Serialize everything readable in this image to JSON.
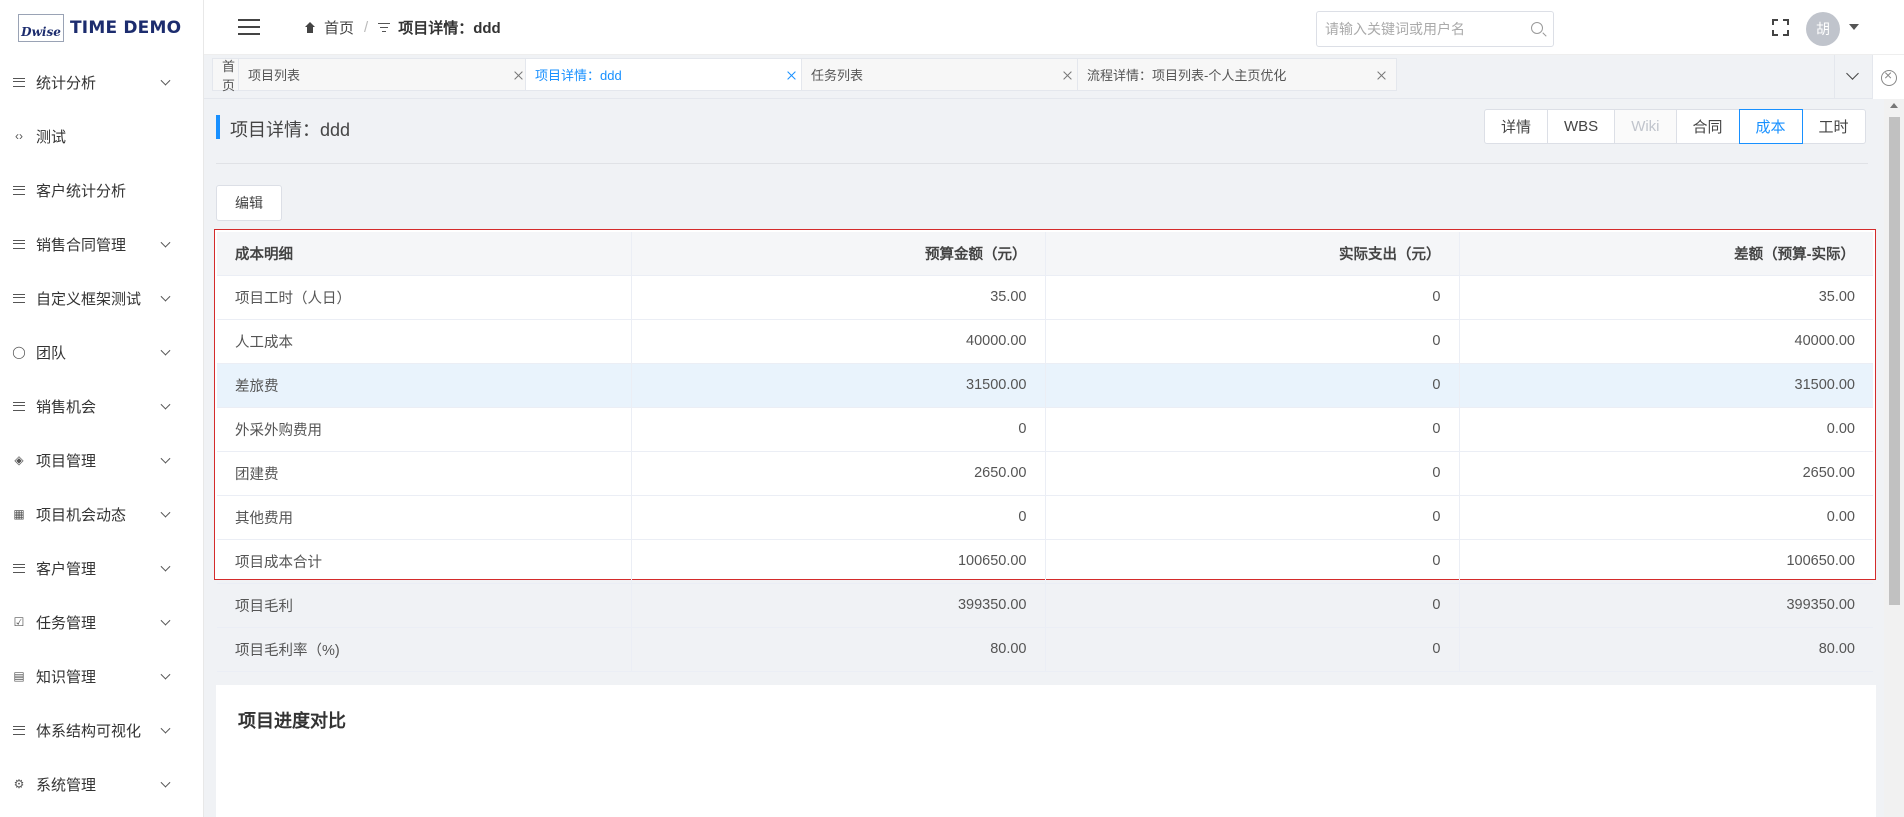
{
  "app": {
    "logo_mark": "Dwise",
    "title": "TIME DEMO"
  },
  "sidebar": {
    "items": [
      {
        "label": "统计分析",
        "icon": "menu-lines-icon",
        "expandable": true
      },
      {
        "label": "测试",
        "icon": "code-icon",
        "expandable": false
      },
      {
        "label": "客户统计分析",
        "icon": "menu-lines-icon",
        "expandable": false
      },
      {
        "label": "销售合同管理",
        "icon": "menu-lines-icon",
        "expandable": true
      },
      {
        "label": "自定义框架测试",
        "icon": "menu-lines-icon",
        "expandable": true
      },
      {
        "label": "团队",
        "icon": "team-icon",
        "expandable": true
      },
      {
        "label": "销售机会",
        "icon": "menu-lines-icon",
        "expandable": true
      },
      {
        "label": "项目管理",
        "icon": "layers-icon",
        "expandable": true
      },
      {
        "label": "项目机会动态",
        "icon": "calendar-icon",
        "expandable": true
      },
      {
        "label": "客户管理",
        "icon": "menu-lines-icon",
        "expandable": true
      },
      {
        "label": "任务管理",
        "icon": "checkbox-icon",
        "expandable": true
      },
      {
        "label": "知识管理",
        "icon": "book-icon",
        "expandable": true
      },
      {
        "label": "体系结构可视化",
        "icon": "menu-lines-icon",
        "expandable": true
      },
      {
        "label": "系统管理",
        "icon": "gear-icon",
        "expandable": true
      }
    ]
  },
  "header": {
    "breadcrumb": {
      "home": "首页",
      "current": "项目详情：ddd"
    },
    "search": {
      "placeholder": "请输入关键词或用户名",
      "value": ""
    },
    "avatar_text": "胡"
  },
  "tabs": [
    {
      "label": "首页",
      "closable": false,
      "active": false
    },
    {
      "label": "项目列表",
      "closable": true,
      "active": false
    },
    {
      "label": "项目详情：ddd",
      "closable": true,
      "active": true
    },
    {
      "label": "任务列表",
      "closable": true,
      "active": false
    },
    {
      "label": "流程详情：项目列表-个人主页优化",
      "closable": true,
      "active": false
    }
  ],
  "page": {
    "title": "项目详情：ddd",
    "segments": [
      {
        "label": "详情",
        "state": "normal"
      },
      {
        "label": "WBS",
        "state": "normal"
      },
      {
        "label": "Wiki",
        "state": "disabled"
      },
      {
        "label": "合同",
        "state": "normal"
      },
      {
        "label": "成本",
        "state": "active"
      },
      {
        "label": "工时",
        "state": "normal"
      }
    ],
    "edit_label": "编辑"
  },
  "cost_table": {
    "headers": [
      "成本明细",
      "预算金额（元）",
      "实际支出（元）",
      "差额（预算-实际）"
    ],
    "rows": [
      [
        "项目工时（人日）",
        "35.00",
        "0",
        "35.00"
      ],
      [
        "人工成本",
        "40000.00",
        "0",
        "40000.00"
      ],
      [
        "差旅费",
        "31500.00",
        "0",
        "31500.00"
      ],
      [
        "外采外购费用",
        "0",
        "0",
        "0.00"
      ],
      [
        "团建费",
        "2650.00",
        "0",
        "2650.00"
      ],
      [
        "其他费用",
        "0",
        "0",
        "0.00"
      ],
      [
        "项目成本合计",
        "100650.00",
        "0",
        "100650.00"
      ],
      [
        "项目毛利",
        "399350.00",
        "0",
        "399350.00"
      ],
      [
        "项目毛利率（%)",
        "80.00",
        "0",
        "80.00"
      ]
    ],
    "highlighted_row": 2
  },
  "progress": {
    "title": "项目进度对比"
  },
  "colors": {
    "accent": "#1890ff",
    "highlight_row": "#e9f3fc",
    "selection_border": "#d42b2b"
  }
}
